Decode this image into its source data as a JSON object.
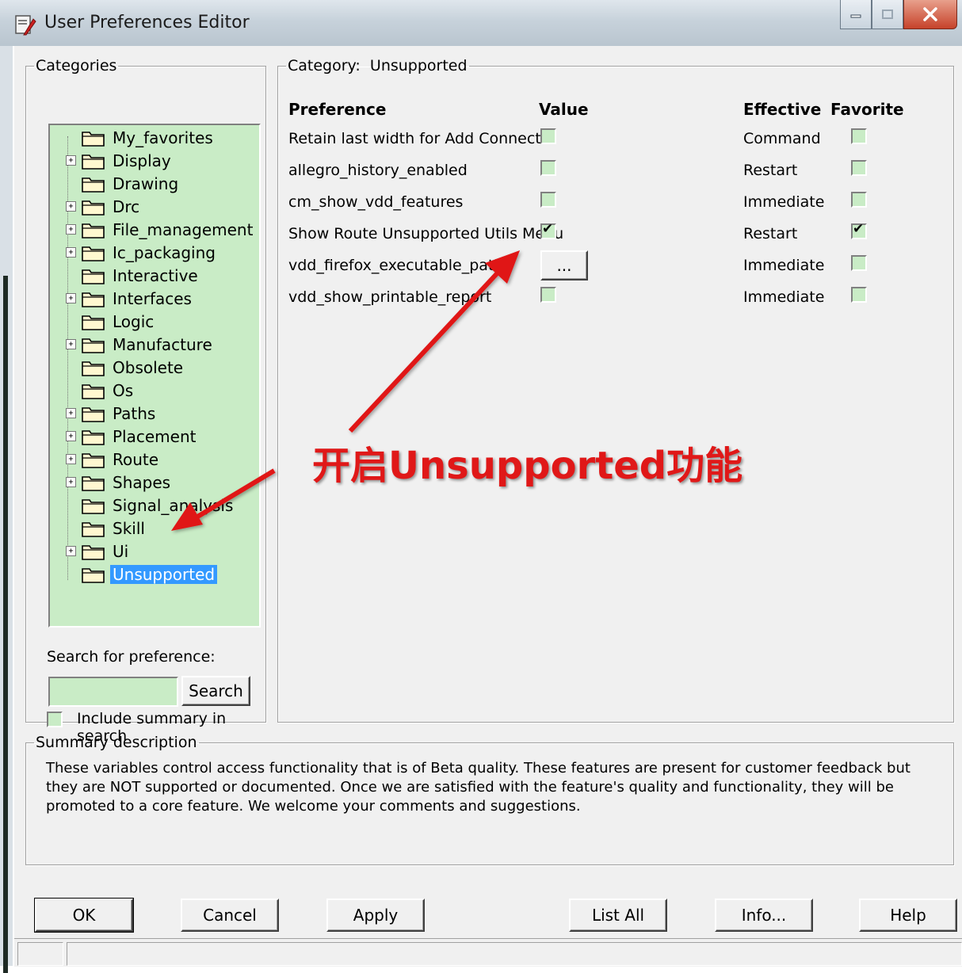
{
  "window": {
    "title": "User Preferences Editor"
  },
  "categories": {
    "legend": "Categories",
    "items": [
      {
        "label": "My_favorites",
        "expandable": false
      },
      {
        "label": "Display",
        "expandable": true
      },
      {
        "label": "Drawing",
        "expandable": false
      },
      {
        "label": "Drc",
        "expandable": true
      },
      {
        "label": "File_management",
        "expandable": true
      },
      {
        "label": "Ic_packaging",
        "expandable": true
      },
      {
        "label": "Interactive",
        "expandable": false
      },
      {
        "label": "Interfaces",
        "expandable": true
      },
      {
        "label": "Logic",
        "expandable": false
      },
      {
        "label": "Manufacture",
        "expandable": true
      },
      {
        "label": "Obsolete",
        "expandable": false
      },
      {
        "label": "Os",
        "expandable": false
      },
      {
        "label": "Paths",
        "expandable": true
      },
      {
        "label": "Placement",
        "expandable": true
      },
      {
        "label": "Route",
        "expandable": true
      },
      {
        "label": "Shapes",
        "expandable": true
      },
      {
        "label": "Signal_analysis",
        "expandable": false
      },
      {
        "label": "Skill",
        "expandable": false
      },
      {
        "label": "Ui",
        "expandable": true
      },
      {
        "label": "Unsupported",
        "expandable": false,
        "selected": true
      }
    ],
    "expand_glyph": "+"
  },
  "search": {
    "label": "Search for preference:",
    "value": "",
    "button": "Search",
    "include_summary_label": "Include summary in search",
    "include_summary_checked": false
  },
  "category_panel": {
    "legend_prefix": "Category:",
    "category_name": "Unsupported",
    "headers": {
      "preference": "Preference",
      "value": "Value",
      "effective": "Effective",
      "favorite": "Favorite"
    },
    "rows": [
      {
        "name": "Retain last width for Add Connect",
        "value_type": "checkbox",
        "value_checked": false,
        "effective": "Command",
        "favorite": false
      },
      {
        "name": "allegro_history_enabled",
        "value_type": "checkbox",
        "value_checked": false,
        "effective": "Restart",
        "favorite": false
      },
      {
        "name": "cm_show_vdd_features",
        "value_type": "checkbox",
        "value_checked": false,
        "effective": "Immediate",
        "favorite": false
      },
      {
        "name": "Show Route Unsupported Utils Menu",
        "value_type": "checkbox",
        "value_checked": true,
        "effective": "Restart",
        "favorite": true
      },
      {
        "name": "vdd_firefox_executable_path",
        "value_type": "button",
        "value_label": "...",
        "effective": "Immediate",
        "favorite": false
      },
      {
        "name": "vdd_show_printable_report",
        "value_type": "checkbox",
        "value_checked": false,
        "effective": "Immediate",
        "favorite": false
      }
    ]
  },
  "summary": {
    "legend": "Summary description",
    "text": "These variables control access functionality that is of Beta quality. These features are present for customer feedback but they are NOT supported or documented. Once we are satisfied with the feature's quality and functionality, they will be promoted to a core feature. We welcome your comments and suggestions."
  },
  "buttons": {
    "ok": "OK",
    "cancel": "Cancel",
    "apply": "Apply",
    "list_all": "List All",
    "info": "Info...",
    "help": "Help"
  },
  "annotation": {
    "text": "开启Unsupported功能",
    "color": "#e01818"
  },
  "colors": {
    "tree_bg": "#c9ecc6",
    "selection": "#3399ff"
  }
}
